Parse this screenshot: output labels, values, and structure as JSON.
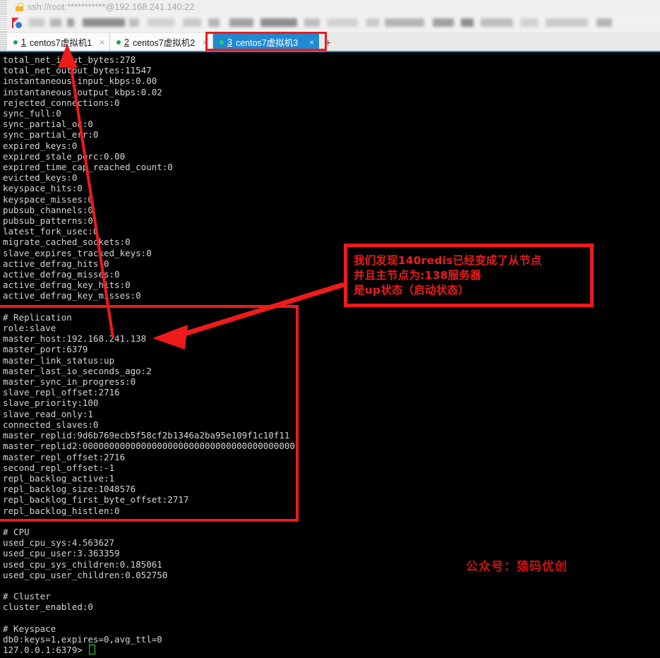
{
  "window": {
    "title": "ssh://root:***********@192.168.241.140:22",
    "lock_icon": "lock-icon",
    "flag_icon": "bookmark-flag-icon"
  },
  "tabs": {
    "add_label": "+",
    "close_glyph": "×",
    "items": [
      {
        "index": "1",
        "label": "centos7虚拟机1",
        "active": false,
        "status": "connected"
      },
      {
        "index": "2",
        "label": "centos7虚拟机2",
        "active": false,
        "status": "connected"
      },
      {
        "index": "3",
        "label": "centos7虚拟机3",
        "active": true,
        "status": "connected"
      }
    ]
  },
  "terminal": {
    "prompt": "127.0.0.1:6379> ",
    "lines": [
      "total_net_input_bytes:278",
      "total_net_output_bytes:11547",
      "instantaneous_input_kbps:0.00",
      "instantaneous_output_kbps:0.02",
      "rejected_connections:0",
      "sync_full:0",
      "sync_partial_ok:0",
      "sync_partial_err:0",
      "expired_keys:0",
      "expired_stale_perc:0.00",
      "expired_time_cap_reached_count:0",
      "evicted_keys:0",
      "keyspace_hits:0",
      "keyspace_misses:0",
      "pubsub_channels:0",
      "pubsub_patterns:0",
      "latest_fork_usec:0",
      "migrate_cached_sockets:0",
      "slave_expires_tracked_keys:0",
      "active_defrag_hits:0",
      "active_defrag_misses:0",
      "active_defrag_key_hits:0",
      "active_defrag_key_misses:0",
      "",
      "# Replication",
      "role:slave",
      "master_host:192.168.241.138",
      "master_port:6379",
      "master_link_status:up",
      "master_last_io_seconds_ago:2",
      "master_sync_in_progress:0",
      "slave_repl_offset:2716",
      "slave_priority:100",
      "slave_read_only:1",
      "connected_slaves:0",
      "master_replid:9d6b769ecb5f58cf2b1346a2ba95e109f1c10f11",
      "master_replid2:0000000000000000000000000000000000000000",
      "master_repl_offset:2716",
      "second_repl_offset:-1",
      "repl_backlog_active:1",
      "repl_backlog_size:1048576",
      "repl_backlog_first_byte_offset:2717",
      "repl_backlog_histlen:0",
      "",
      "# CPU",
      "used_cpu_sys:4.563627",
      "used_cpu_user:3.363359",
      "used_cpu_sys_children:0.185061",
      "used_cpu_user_children:0.052750",
      "",
      "# Cluster",
      "cluster_enabled:0",
      "",
      "# Keyspace",
      "db0:keys=1,expires=0,avg_ttl=0"
    ]
  },
  "annotations": {
    "note_lines": [
      "我们发现140redis已经变成了从节点",
      "并且主节点为:138服务器",
      "是up状态（启动状态）"
    ],
    "watermark": "公众号：猿码优创",
    "accent_red": "#ee1b1b",
    "accent_blue": "#1f8ad2"
  }
}
